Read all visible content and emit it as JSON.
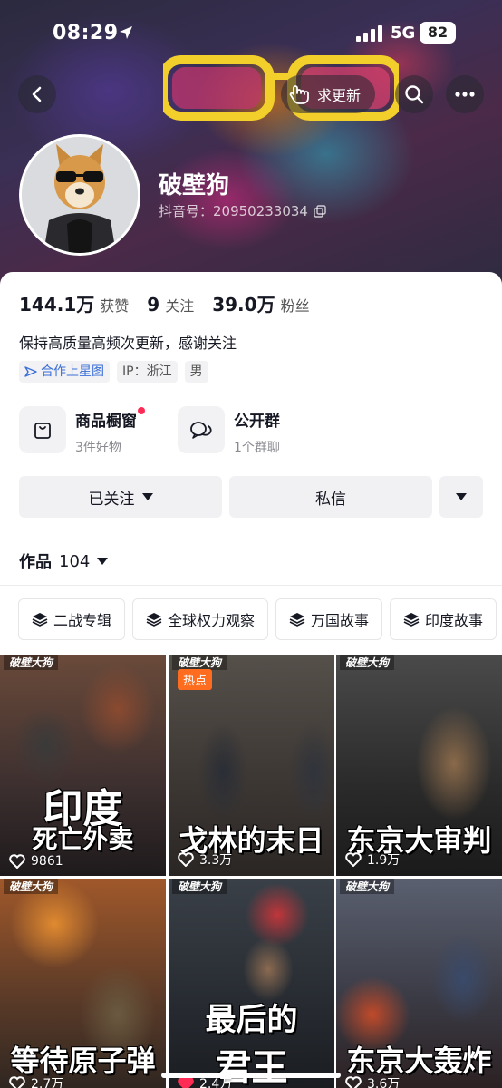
{
  "status": {
    "time": "08:29",
    "network": "5G",
    "battery": "82"
  },
  "header": {
    "update_label": "求更新"
  },
  "profile": {
    "name": "破壁狗",
    "douyin_id": "抖音号：20950233034",
    "stats": [
      {
        "value": "144.1万",
        "label": "获赞"
      },
      {
        "value": "9",
        "label": "关注"
      },
      {
        "value": "39.0万",
        "label": "粉丝"
      }
    ],
    "bio": "保持高质量高频次更新，感谢关注",
    "tags": [
      "合作上星图",
      "IP：浙江",
      "男"
    ]
  },
  "shop": [
    {
      "title": "商品橱窗",
      "sub": "3件好物",
      "icon": "shopping-bag-icon"
    },
    {
      "title": "公开群",
      "sub": "1个群聊",
      "icon": "chat-bubbles-icon"
    }
  ],
  "actions": {
    "follow": "已关注",
    "message": "私信"
  },
  "works": {
    "label": "作品",
    "count": "104"
  },
  "collections": [
    "二战专辑",
    "全球权力观察",
    "万国故事",
    "印度故事"
  ],
  "videos": [
    {
      "brand": "破壁大狗",
      "hot": "",
      "title_line1": "印度",
      "title_line2": "死亡外卖",
      "likes": "9861"
    },
    {
      "brand": "破壁大狗",
      "hot": "热点",
      "title_line1": "",
      "title_line2": "戈林的末日",
      "likes": "3.3万"
    },
    {
      "brand": "破壁大狗",
      "hot": "",
      "title_line1": "",
      "title_line2": "东京大审判",
      "likes": "1.9万"
    },
    {
      "brand": "破壁大狗",
      "hot": "",
      "title_line1": "",
      "title_line2": "等待原子弹",
      "likes": "2.7万"
    },
    {
      "brand": "破壁大狗",
      "hot": "",
      "title_line1": "最后的",
      "title_line2": "君王",
      "likes": "2.4万"
    },
    {
      "brand": "破壁大狗",
      "hot": "",
      "title_line1": "",
      "title_line2": "东京大轰炸",
      "likes": "3.6万"
    }
  ],
  "colors": {
    "accent_red": "#fe2c55",
    "hot_orange": "#fe6d1f",
    "link_blue": "#3b6fd8"
  }
}
